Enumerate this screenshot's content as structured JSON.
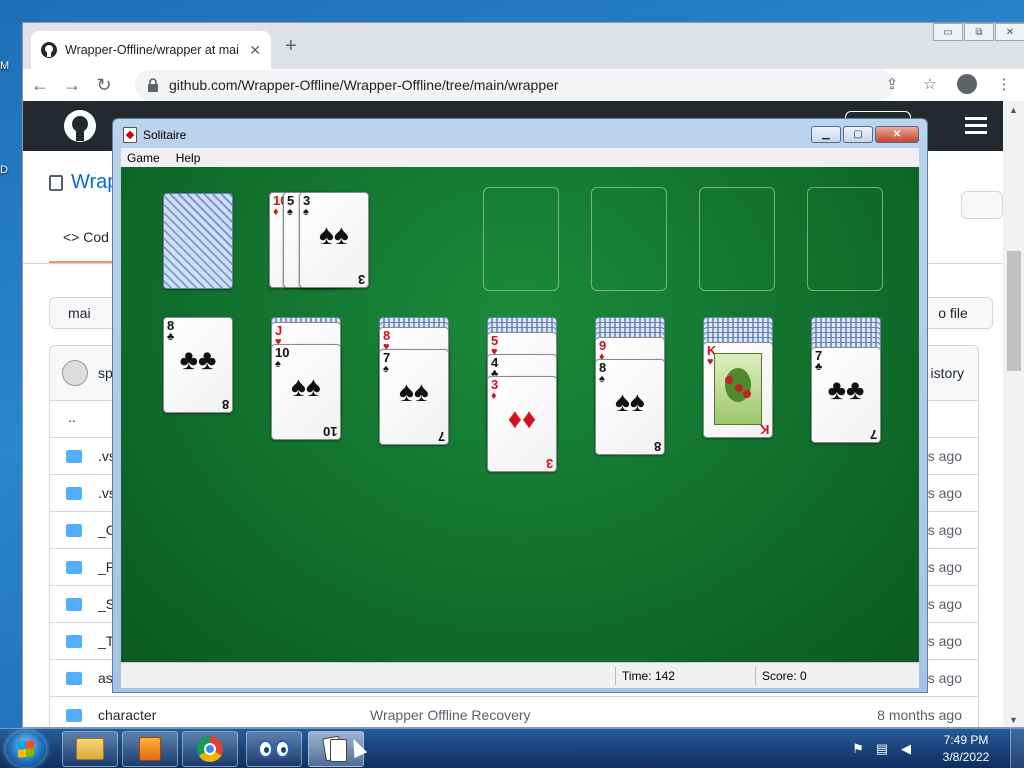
{
  "desktop": {
    "label_m": "M",
    "label_d": "D"
  },
  "browser": {
    "tab_title": "Wrapper-Offline/wrapper at mai",
    "close_tab": "✕",
    "new_tab": "+",
    "url": "github.com/Wrapper-Offline/Wrapper-Offline/tree/main/wrapper",
    "back": "←",
    "forward": "→",
    "reload": "↻",
    "share": "⇪",
    "star": "☆",
    "menu": "⋮",
    "window_buttons": [
      "▭",
      "⧉",
      "✕"
    ]
  },
  "github": {
    "repo_title": "Wrap",
    "code_tab": "<> Cod",
    "branch": "mai",
    "add_file": "o file",
    "commit_user": "sp",
    "history": "istory",
    "parent_dir": "..",
    "files": [
      {
        "name": ".vs",
        "message": "",
        "age": "s ago"
      },
      {
        "name": ".vs",
        "message": "",
        "age": "s ago"
      },
      {
        "name": "_C",
        "message": "",
        "age": "s ago"
      },
      {
        "name": "_P",
        "message": "",
        "age": "s ago"
      },
      {
        "name": "_S",
        "message": "",
        "age": "s ago"
      },
      {
        "name": "_T",
        "message": "",
        "age": "s ago"
      },
      {
        "name": "as",
        "message": "",
        "age": "s ago"
      },
      {
        "name": "character",
        "message": "Wrapper Offline Recovery",
        "age": "8 months ago"
      }
    ]
  },
  "solitaire": {
    "title": "Solitaire",
    "menu": [
      "Game",
      "Help"
    ],
    "buttons": {
      "minimize": "▁",
      "maximize": "▢",
      "close": "✕"
    },
    "status": {
      "time_label": "Time:",
      "time_value": "142",
      "score_label": "Score:",
      "score_value": "0"
    },
    "waste": [
      {
        "rank": "10",
        "suit": "♦",
        "color": "red"
      },
      {
        "rank": "5",
        "suit": "♠",
        "color": "black"
      },
      {
        "rank": "3",
        "suit": "♠",
        "color": "black"
      }
    ],
    "foundations": [
      "",
      "",
      "",
      ""
    ],
    "tableau": [
      {
        "hidden": 0,
        "cards": [
          {
            "rank": "8",
            "suit": "♣",
            "color": "black"
          }
        ]
      },
      {
        "hidden": 1,
        "cards": [
          {
            "rank": "J",
            "suit": "♥",
            "color": "red"
          },
          {
            "rank": "10",
            "suit": "♠",
            "color": "black"
          }
        ]
      },
      {
        "hidden": 2,
        "cards": [
          {
            "rank": "8",
            "suit": "♥",
            "color": "red"
          },
          {
            "rank": "7",
            "suit": "♠",
            "color": "black"
          }
        ]
      },
      {
        "hidden": 3,
        "cards": [
          {
            "rank": "5",
            "suit": "♥",
            "color": "red"
          },
          {
            "rank": "4",
            "suit": "♣",
            "color": "black"
          },
          {
            "rank": "3",
            "suit": "♦",
            "color": "red"
          }
        ]
      },
      {
        "hidden": 4,
        "cards": [
          {
            "rank": "9",
            "suit": "♦",
            "color": "red"
          },
          {
            "rank": "8",
            "suit": "♠",
            "color": "black"
          }
        ]
      },
      {
        "hidden": 5,
        "cards": [
          {
            "rank": "K",
            "suit": "♥",
            "color": "red"
          }
        ]
      },
      {
        "hidden": 6,
        "cards": [
          {
            "rank": "7",
            "suit": "♣",
            "color": "black"
          }
        ]
      }
    ]
  },
  "taskbar": {
    "apps": [
      "explorer-icon",
      "media-center-icon",
      "chrome-icon",
      "eyes-icon",
      "solitaire-icon"
    ],
    "clock_time": "7:49 PM",
    "clock_date": "3/8/2022"
  }
}
